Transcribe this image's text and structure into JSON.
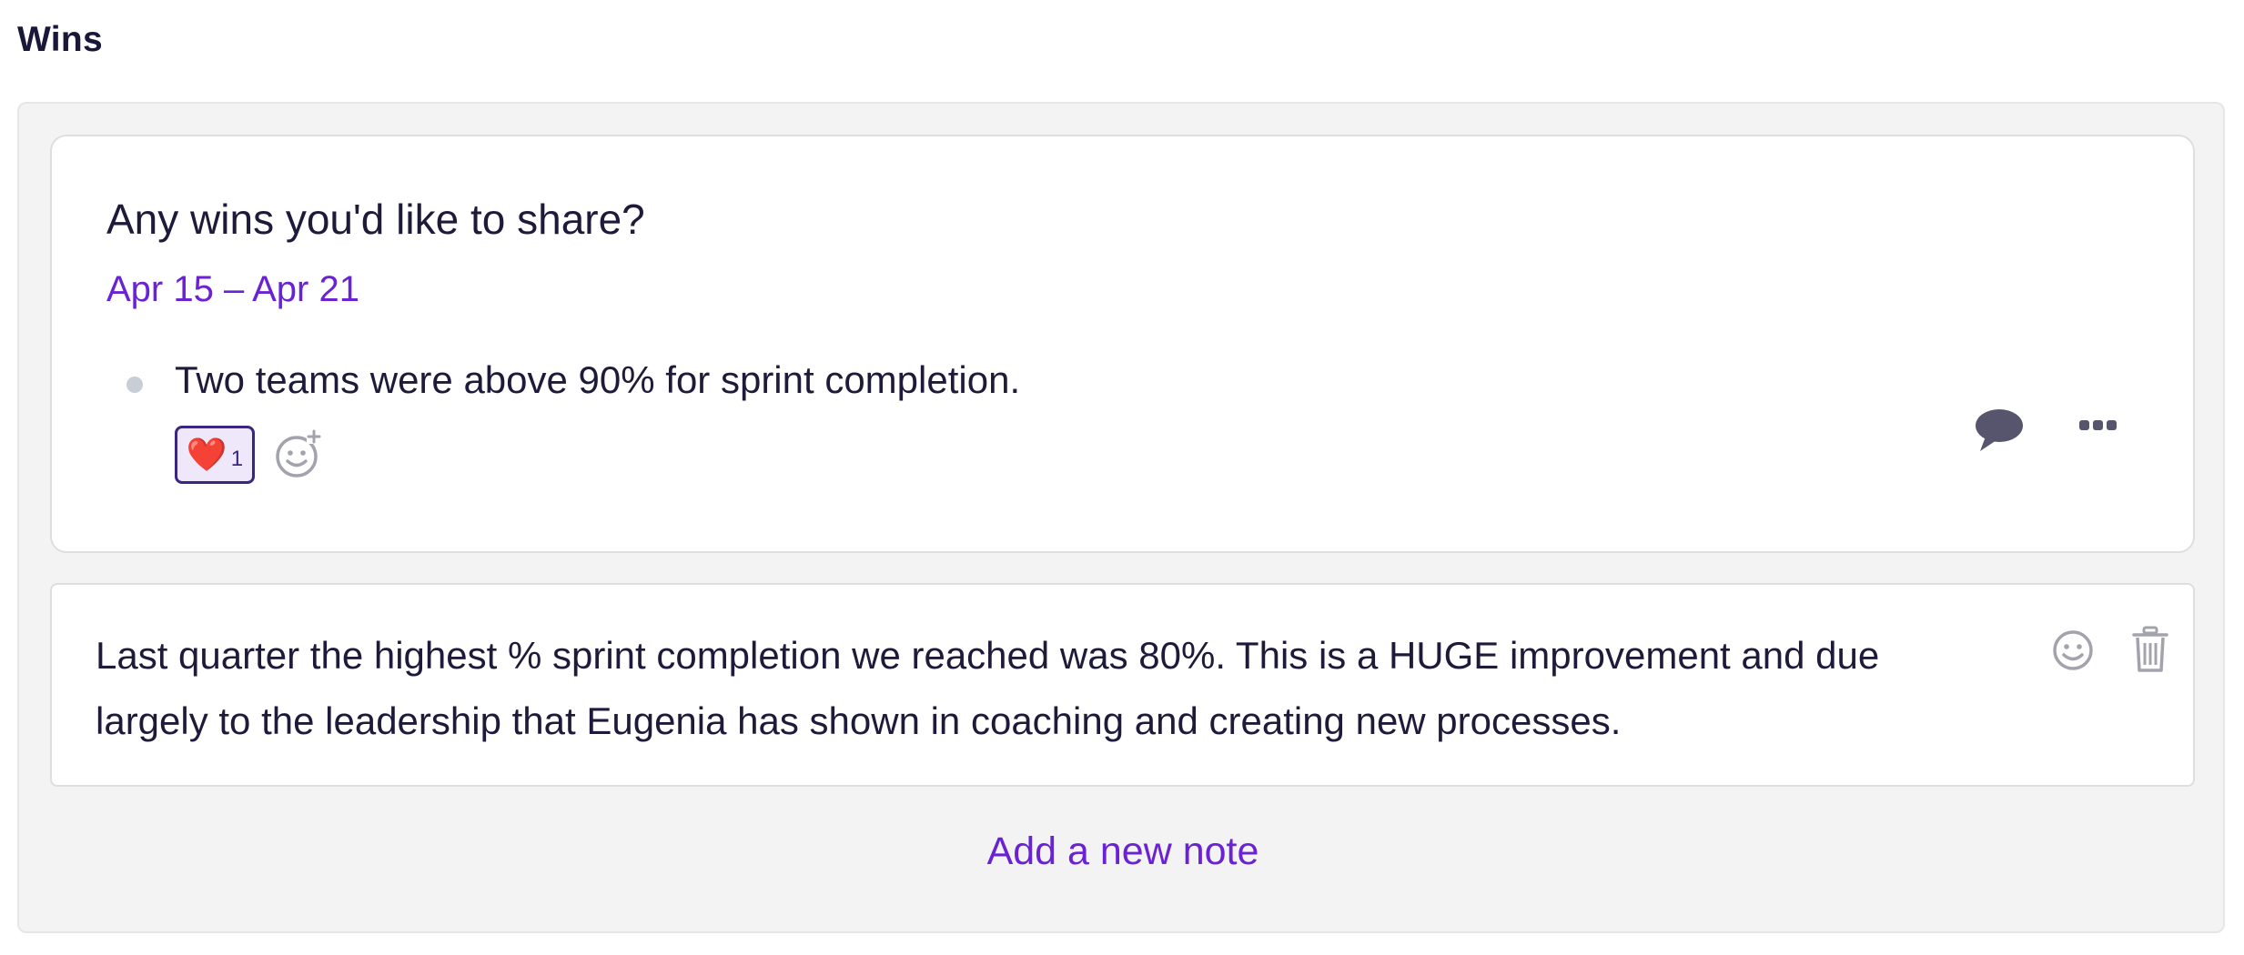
{
  "section": {
    "title": "Wins"
  },
  "question_card": {
    "question": "Any wins you'd like to share?",
    "date_range": "Apr 15 – Apr 21",
    "answer": "Two teams were above 90% for sprint completion.",
    "reaction": {
      "emoji": "❤️",
      "count": "1"
    },
    "icons": {
      "add_reaction": "add-emoji-icon",
      "comment": "comment-icon",
      "more": "more-options-icon"
    }
  },
  "note_card": {
    "text": "Last quarter the highest % sprint completion we reached was 80%. This is a HUGE improvement and due largely to the leadership that Eugenia has shown in coaching and creating new processes.",
    "icons": {
      "emoji": "emoji-icon",
      "delete": "trash-icon"
    }
  },
  "actions": {
    "add_note": "Add a new note"
  },
  "colors": {
    "accent": "#6a22d4",
    "text": "#1e1a3a",
    "panel_bg": "#f3f3f3",
    "icon_gray": "#a3a3ad",
    "icon_dark": "#57546d"
  }
}
